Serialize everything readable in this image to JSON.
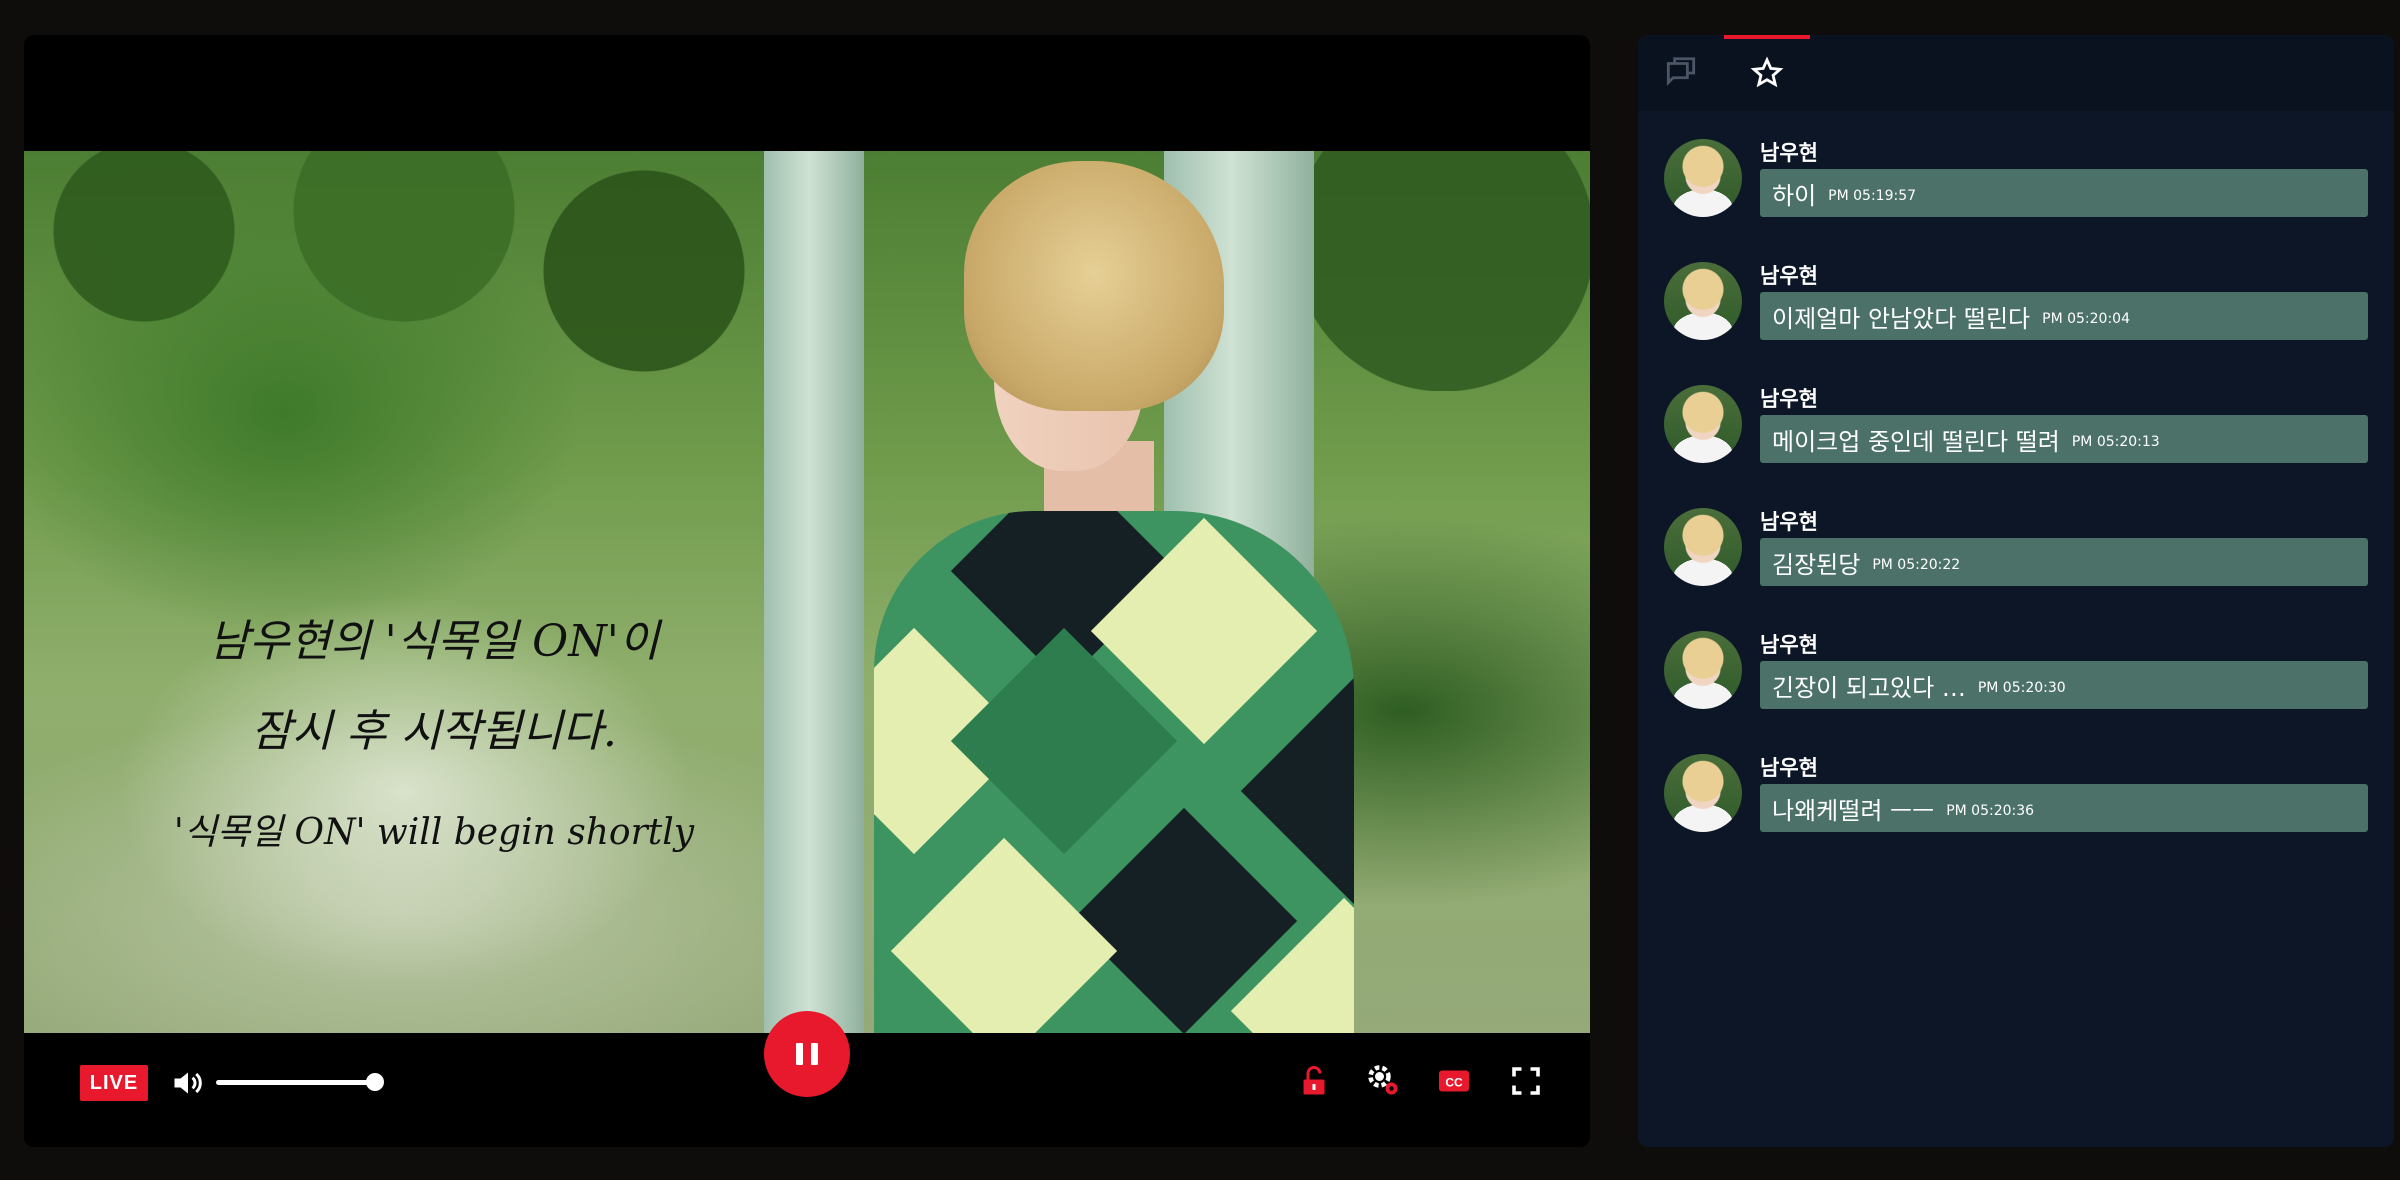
{
  "player": {
    "overlay": {
      "line1": "남우현의 '식목일 ON'이",
      "line2": "잠시 후 시작됩니다.",
      "line3": "'식목일 ON' will begin shortly"
    },
    "live_label": "LIVE",
    "volume": 1.0,
    "icons": [
      "volume-icon",
      "pause-icon",
      "unlock-icon",
      "settings-icon",
      "cc-icon",
      "fullscreen-icon"
    ],
    "accent": "#e8192c"
  },
  "chat": {
    "tabs": [
      {
        "icon": "chat-icon",
        "active": false
      },
      {
        "icon": "star-icon",
        "active": true
      }
    ],
    "messages": [
      {
        "name": "남우현",
        "text": "하이",
        "time": "PM 05:19:57"
      },
      {
        "name": "남우현",
        "text": "이제얼마 안남았다 떨린다",
        "time": "PM 05:20:04"
      },
      {
        "name": "남우현",
        "text": "메이크업 중인데 떨린다 떨려",
        "time": "PM 05:20:13"
      },
      {
        "name": "남우현",
        "text": "김장된당",
        "time": "PM 05:20:22"
      },
      {
        "name": "남우현",
        "text": "긴장이 되고있다 …",
        "time": "PM 05:20:30"
      },
      {
        "name": "남우현",
        "text": "나왜케떨려 ㅡㅡ",
        "time": "PM 05:20:36"
      }
    ],
    "bubble_color": "#4b7168",
    "panel_color": "#0d1626"
  }
}
